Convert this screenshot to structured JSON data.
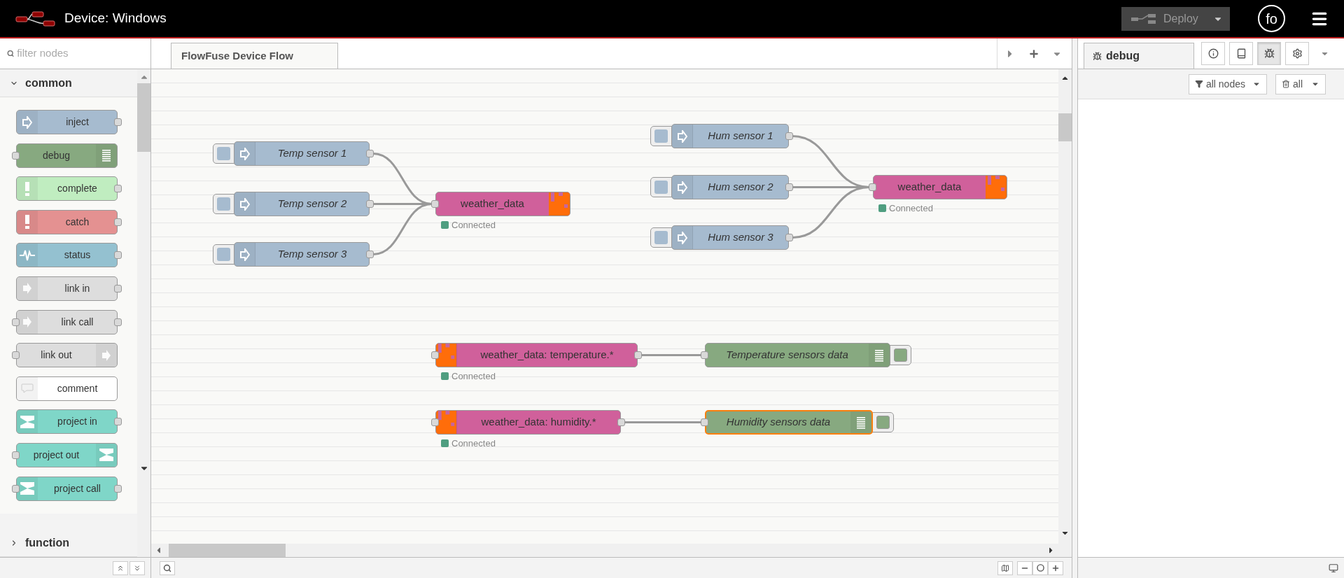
{
  "header": {
    "title": "Device: Windows",
    "deploy": "Deploy",
    "user": "fo"
  },
  "palette": {
    "filter_placeholder": "filter nodes",
    "categories": [
      {
        "label": "common",
        "expanded": true,
        "nodes": [
          {
            "label": "inject",
            "kind": "inject",
            "color": "#a6bbcf",
            "input": false,
            "output": true
          },
          {
            "label": "debug",
            "kind": "debug",
            "color": "#87a980",
            "input": true,
            "output": false
          },
          {
            "label": "complete",
            "kind": "alert",
            "color": "#c0edc0",
            "input": false,
            "output": true
          },
          {
            "label": "catch",
            "kind": "alert",
            "color": "#e49191",
            "input": false,
            "output": true
          },
          {
            "label": "status",
            "kind": "status",
            "color": "#94c1d0",
            "input": false,
            "output": true
          },
          {
            "label": "link in",
            "kind": "link",
            "color": "#dddddd",
            "input": false,
            "output": true
          },
          {
            "label": "link call",
            "kind": "link",
            "color": "#dddddd",
            "input": true,
            "output": true
          },
          {
            "label": "link out",
            "kind": "link",
            "color": "#dddddd",
            "input": true,
            "output": false
          },
          {
            "label": "comment",
            "kind": "comment",
            "color": "#ffffff",
            "input": false,
            "output": false
          },
          {
            "label": "project in",
            "kind": "project",
            "color": "#7fd6c8",
            "input": false,
            "output": true
          },
          {
            "label": "project out",
            "kind": "project",
            "color": "#7fd6c8",
            "input": true,
            "output": false
          },
          {
            "label": "project call",
            "kind": "project",
            "color": "#7fd6c8",
            "input": true,
            "output": true
          }
        ]
      },
      {
        "label": "function",
        "expanded": false
      }
    ]
  },
  "workspace": {
    "tabs": [
      {
        "label": "FlowFuse Device Flow",
        "selected": true
      }
    ]
  },
  "flow": {
    "nodes": [
      {
        "label": "Temp sensor 1",
        "kind": "inject",
        "color": "#a6bbcf",
        "input": false,
        "output": true,
        "selected": false
      },
      {
        "label": "Temp sensor 2",
        "kind": "inject",
        "color": "#a6bbcf",
        "input": false,
        "output": true,
        "selected": false
      },
      {
        "label": "Temp sensor 3",
        "kind": "inject",
        "color": "#a6bbcf",
        "input": false,
        "output": true,
        "selected": false
      },
      {
        "label": "weather_data",
        "kind": "mqtt-out",
        "color": "#d0609b",
        "input": true,
        "output": false,
        "selected": false,
        "status": {
          "text": "Connected",
          "color": "#4f9e80"
        }
      },
      {
        "label": "Hum sensor 1",
        "kind": "inject",
        "color": "#a6bbcf",
        "input": false,
        "output": true,
        "selected": false
      },
      {
        "label": "Hum sensor 2",
        "kind": "inject",
        "color": "#a6bbcf",
        "input": false,
        "output": true,
        "selected": false
      },
      {
        "label": "Hum sensor 3",
        "kind": "inject",
        "color": "#a6bbcf",
        "input": false,
        "output": true,
        "selected": false
      },
      {
        "label": "weather_data",
        "kind": "mqtt-out",
        "color": "#d0609b",
        "input": true,
        "output": false,
        "selected": false,
        "status": {
          "text": "Connected",
          "color": "#4f9e80"
        }
      },
      {
        "label": "weather_data: temperature.*",
        "kind": "mqtt-in",
        "color": "#d0609b",
        "input": true,
        "output": true,
        "selected": false,
        "status": {
          "text": "Connected",
          "color": "#4f9e80"
        }
      },
      {
        "label": "Temperature sensors data",
        "kind": "debug",
        "color": "#87a980",
        "input": true,
        "output": false,
        "selected": false,
        "active": true
      },
      {
        "label": "weather_data: humidity.*",
        "kind": "mqtt-in",
        "color": "#d0609b",
        "input": true,
        "output": true,
        "selected": false,
        "status": {
          "text": "Connected",
          "color": "#4f9e80"
        }
      },
      {
        "label": "Humidity sensors data",
        "kind": "debug",
        "color": "#87a980",
        "input": true,
        "output": false,
        "selected": true,
        "active": true
      }
    ]
  },
  "sidebar": {
    "tabs": [
      {
        "label": "debug",
        "selected": true
      }
    ],
    "buttons": [
      {
        "kind": "info",
        "selected": false
      },
      {
        "kind": "help",
        "selected": false
      },
      {
        "kind": "debug",
        "selected": true
      },
      {
        "kind": "config",
        "selected": false
      }
    ],
    "filter": "all nodes",
    "clear": "all"
  }
}
